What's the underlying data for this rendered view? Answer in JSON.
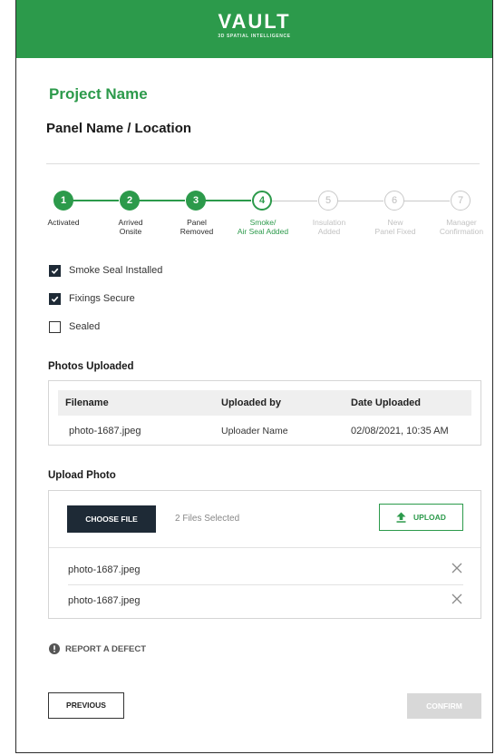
{
  "brand": {
    "logo": "VAULT",
    "tagline": "3D SPATIAL INTELLIGENCE",
    "color": "#2c9a4b"
  },
  "project_name": "Project Name",
  "panel_name": "Panel Name / Location",
  "steps": [
    {
      "number": "1",
      "label_line1": "",
      "label_line2": "Activated",
      "state": "done"
    },
    {
      "number": "2",
      "label_line1": "Arrived",
      "label_line2": "Onsite",
      "state": "done"
    },
    {
      "number": "3",
      "label_line1": "Panel",
      "label_line2": "Removed",
      "state": "done"
    },
    {
      "number": "4",
      "label_line1": "Smoke/",
      "label_line2": "Air Seal Added",
      "state": "active"
    },
    {
      "number": "5",
      "label_line1": "Insulation",
      "label_line2": "Added",
      "state": "todo"
    },
    {
      "number": "6",
      "label_line1": "New",
      "label_line2": "Panel Fixed",
      "state": "todo"
    },
    {
      "number": "7",
      "label_line1": "Manager",
      "label_line2": "Confirmation",
      "state": "todo"
    }
  ],
  "checklist": [
    {
      "label": "Smoke Seal Installed",
      "checked": true
    },
    {
      "label": "Fixings Secure",
      "checked": true
    },
    {
      "label": "Sealed",
      "checked": false
    }
  ],
  "photos": {
    "title": "Photos Uploaded",
    "columns": [
      "Filename",
      "Uploaded by",
      "Date Uploaded"
    ],
    "rows": [
      [
        "photo-1687.jpeg",
        "Uploader Name",
        "02/08/2021, 10:35 AM"
      ]
    ]
  },
  "upload": {
    "title": "Upload Photo",
    "choose_label": "CHOOSE FILE",
    "files_selected": "2 Files Selected",
    "upload_label": "UPLOAD",
    "files": [
      "photo-1687.jpeg",
      "photo-1687.jpeg"
    ]
  },
  "defect_label": "REPORT A DEFECT",
  "buttons": {
    "previous": "PREVIOUS",
    "confirm": "CONFIRM"
  }
}
